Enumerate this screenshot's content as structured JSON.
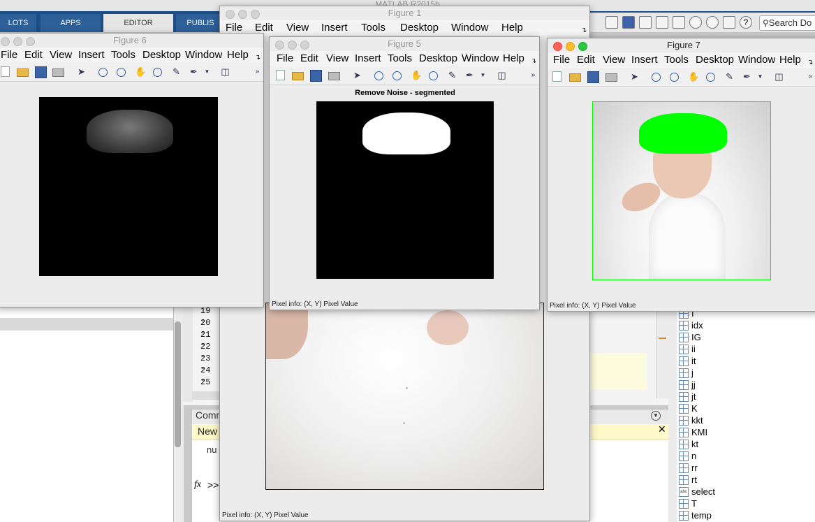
{
  "matlab": {
    "title": "MATLAB R2015b",
    "tabs": [
      "LOTS",
      "APPS",
      "EDITOR",
      "PUBLIS"
    ],
    "search_placeholder": "Search Do",
    "editor_line_numbers": [
      "19",
      "20",
      "21",
      "22",
      "23",
      "24",
      "25"
    ],
    "command_window": {
      "title": "Comm",
      "new_banner": "New",
      "output_text": "nu",
      "fx_label": "fx",
      "prompt": ">>"
    },
    "workspace_vars": [
      {
        "name": "I",
        "type": "matrix"
      },
      {
        "name": "idx",
        "type": "matrix"
      },
      {
        "name": "IG",
        "type": "matrix"
      },
      {
        "name": "ii",
        "type": "matrix"
      },
      {
        "name": "it",
        "type": "matrix"
      },
      {
        "name": "j",
        "type": "matrix"
      },
      {
        "name": "jj",
        "type": "matrix"
      },
      {
        "name": "jt",
        "type": "matrix"
      },
      {
        "name": "K",
        "type": "matrix"
      },
      {
        "name": "kkt",
        "type": "matrix"
      },
      {
        "name": "KMI",
        "type": "matrix"
      },
      {
        "name": "kt",
        "type": "matrix"
      },
      {
        "name": "n",
        "type": "matrix"
      },
      {
        "name": "rr",
        "type": "matrix"
      },
      {
        "name": "rt",
        "type": "matrix"
      },
      {
        "name": "select",
        "type": "char"
      },
      {
        "name": "T",
        "type": "matrix"
      },
      {
        "name": "temp",
        "type": "matrix"
      }
    ]
  },
  "figure_menu": [
    "File",
    "Edit",
    "View",
    "Insert",
    "Tools",
    "Desktop",
    "Window",
    "Help"
  ],
  "figure_menu_truncated": [
    "File",
    "Edit",
    "View",
    "Insert",
    "Tools",
    "Desktop",
    "Window",
    "Help"
  ],
  "figure_status": "Pixel info: (X, Y)  Pixel Value",
  "figures": {
    "fig1": {
      "title": "Figure 1"
    },
    "fig6": {
      "title": "Figure 6"
    },
    "fig5": {
      "title": "Figure 5",
      "axes_title": "Remove Noise - segmented"
    },
    "fig7": {
      "title": "Figure 7"
    }
  },
  "colors": {
    "segment_green": "#00ff00",
    "tab_blue": "#1d4e86"
  }
}
